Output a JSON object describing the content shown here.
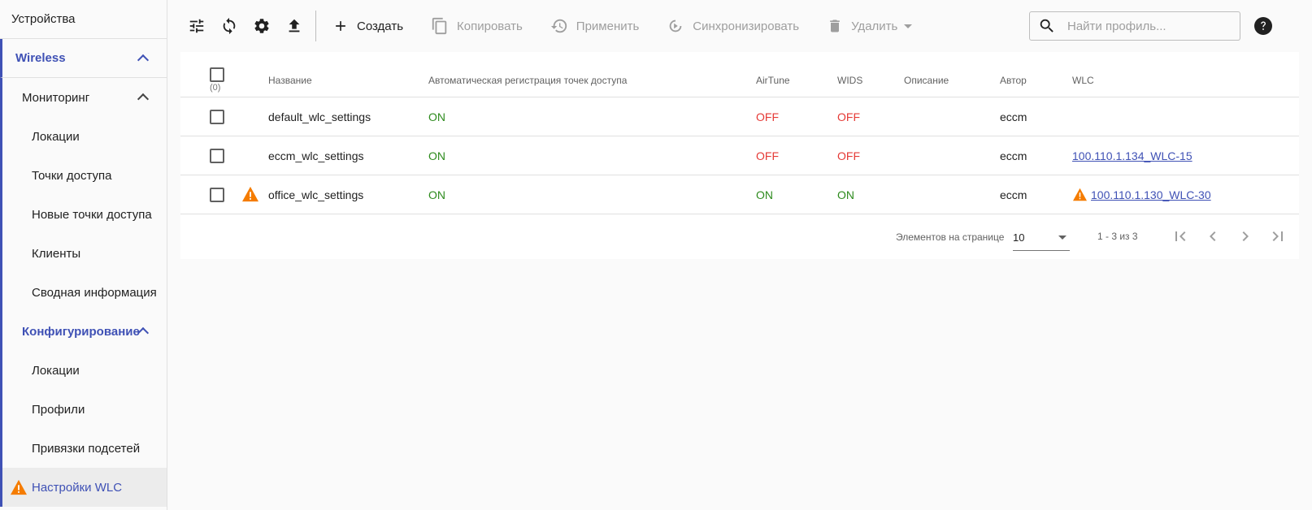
{
  "sidebar": {
    "top_item": "Устройства",
    "section": "Wireless",
    "monitoring": {
      "label": "Мониторинг",
      "items": [
        "Локации",
        "Точки доступа",
        "Новые точки доступа",
        "Клиенты",
        "Сводная информация"
      ]
    },
    "config": {
      "label": "Конфигурирование",
      "items": [
        "Локации",
        "Профили",
        "Привязки подсетей",
        "Настройки WLC"
      ]
    }
  },
  "toolbar": {
    "create": "Создать",
    "copy": "Копировать",
    "apply": "Применить",
    "sync": "Синхронизировать",
    "delete": "Удалить"
  },
  "search": {
    "placeholder": "Найти профиль..."
  },
  "table": {
    "select_count": "(0)",
    "headers": {
      "name": "Название",
      "auto_reg": "Автоматическая регистрация точек доступа",
      "airtune": "AirTune",
      "wids": "WIDS",
      "description": "Описание",
      "author": "Автор",
      "wlc": "WLC"
    },
    "rows": [
      {
        "name": "default_wlc_settings",
        "auto_reg": "ON",
        "airtune": "OFF",
        "wids": "OFF",
        "description": "",
        "author": "eccm",
        "wlc": ""
      },
      {
        "name": "eccm_wlc_settings",
        "auto_reg": "ON",
        "airtune": "OFF",
        "wids": "OFF",
        "description": "",
        "author": "eccm",
        "wlc": "100.110.1.134_WLC-15"
      },
      {
        "name": "office_wlc_settings",
        "auto_reg": "ON",
        "airtune": "ON",
        "wids": "ON",
        "description": "",
        "author": "eccm",
        "wlc": "100.110.1.130_WLC-30"
      }
    ]
  },
  "paginator": {
    "label": "Элементов на странице",
    "page_size": "10",
    "range": "1 - 3 из 3"
  },
  "colors": {
    "accent": "#3f51b5",
    "on": "#2e8b1e",
    "off": "#e53935",
    "warning": "#f57c00"
  }
}
